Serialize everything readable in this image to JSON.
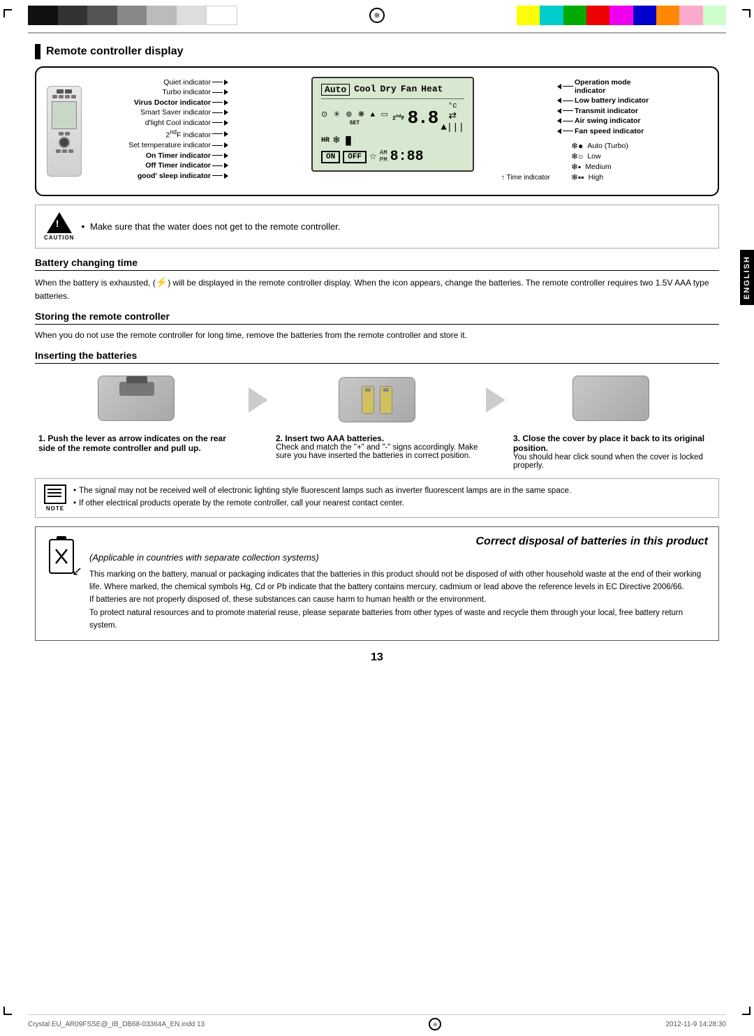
{
  "page": {
    "number": "13",
    "footer_left": "Crystal EU_AR09FSSE@_IB_DB68-03364A_EN.indd   13",
    "footer_right": "2012-11-9   14:28:30"
  },
  "colors": {
    "black_bar": "#1a1a1a",
    "top_colors_left": [
      "#111111",
      "#333333",
      "#666666",
      "#999999",
      "#cccccc",
      "#eeeeee",
      "#ffffff"
    ],
    "top_colors_right": [
      "#ffff00",
      "#00ffff",
      "#00cc00",
      "#ff0000",
      "#ff00ff",
      "#0000ff",
      "#ff8800",
      "#ffaacc",
      "#aaffaa"
    ]
  },
  "top_bar": {
    "compass_symbol": "⊕"
  },
  "english_tab": "ENGLISH",
  "section_remote": {
    "title": "Remote controller display",
    "left_labels": [
      "Quiet indicator",
      "Turbo indicator",
      "Virus Doctor indicator",
      "Smart Saver indicator",
      "d'light Cool indicator",
      "2nd F indicator",
      "Set temperature indicator",
      "On Timer indicator",
      "Off Timer indicator",
      "good' sleep indicator"
    ],
    "right_labels": [
      "Operation mode indicator",
      "Low battery indicator",
      "Transmit indicator",
      "Air swing indicator",
      "Fan speed indicator"
    ],
    "lcd_modes": [
      "Auto",
      "Cool",
      "Dry",
      "Fan",
      "Heat"
    ],
    "lcd_set": "SET",
    "lcd_2ndf": "2nd F",
    "lcd_temp": "8.8",
    "lcd_celsius": "°c",
    "lcd_hr": "HR",
    "lcd_on": "ON",
    "lcd_off": "OFF",
    "lcd_am": "AM",
    "lcd_pm": "PM",
    "lcd_time": "8:88",
    "time_label": "Time indicator",
    "fan_speed_title": "Fan speed indicator",
    "fan_speeds": [
      {
        "icon": "❄●",
        "label": "Auto (Turbo)"
      },
      {
        "icon": "❄○",
        "label": "Low"
      },
      {
        "icon": "❄▪",
        "label": "Medium"
      },
      {
        "icon": "❄▪▪",
        "label": "High"
      }
    ]
  },
  "caution": {
    "icon_label": "CAUTION",
    "text": "Make sure that the water does not get to the remote controller."
  },
  "battery_section": {
    "title": "Battery changing time",
    "body": "When the battery is exhausted, (     ) will be displayed in the remote controller display. When the icon appears, change the batteries. The remote controller requires two 1.5V AAA type batteries."
  },
  "storing_section": {
    "title": "Storing the remote controller",
    "body": "When you do not use the remote controller for long time, remove the batteries from the remote controller and store it."
  },
  "inserting_section": {
    "title": "Inserting the batteries",
    "steps": [
      {
        "number": "1.",
        "bold": "Push the lever as arrow indicates on the rear side of the remote controller and pull up."
      },
      {
        "number": "2.",
        "bold": "Insert two AAA batteries.",
        "normal": "Check and match the \"+\" and \"-\" signs accordingly. Make sure you have inserted the batteries in correct position."
      },
      {
        "number": "3.",
        "bold": "Close the cover by place it back to its original position.",
        "normal": "You should hear click sound when the cover is locked properly."
      }
    ]
  },
  "note": {
    "label": "NOTE",
    "items": [
      "The signal may not be received well of electronic lighting style fluorescent lamps such as inverter fluorescent lamps are in the same space.",
      "If other electrical products operate by the remote controller, call your nearest contact center."
    ]
  },
  "disposal": {
    "title": "Correct disposal of batteries in this product",
    "subtitle": "(Applicable in  countries with separate collection systems)",
    "body": "This marking on the battery, manual or packaging indicates that the batteries in this product should not be disposed of with other household waste at the end of their working life. Where marked, the chemical symbols Hg, Cd or Pb indicate that the battery contains mercury, cadmium or lead above the reference levels in EC Directive 2006/66.\nIf batteries are not properly disposed of, these substances can cause harm to human health or the environment.\nTo protect natural resources and to promote material reuse, please separate batteries from other types of waste and recycle them through your local, free battery return system."
  }
}
